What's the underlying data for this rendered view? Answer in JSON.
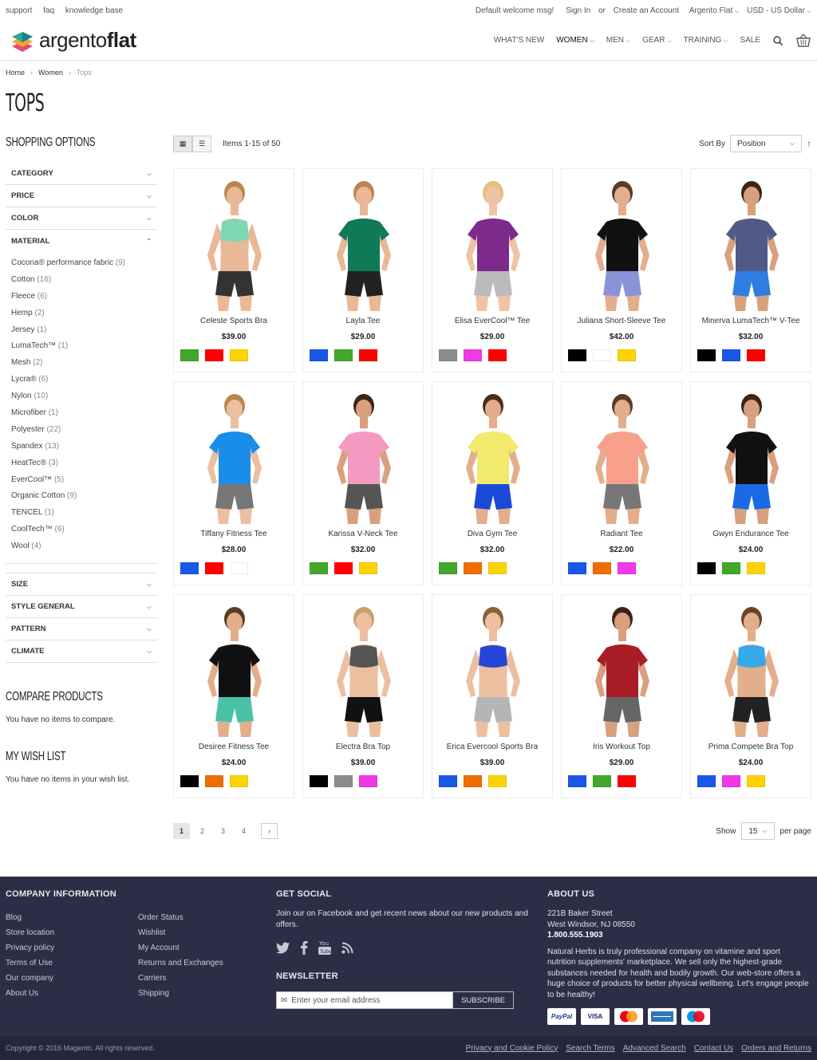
{
  "topbar": {
    "links": [
      "support",
      "faq",
      "knowledge base"
    ],
    "welcome": "Default welcome msg!",
    "sign_in": "Sign In",
    "or": "or",
    "create_account": "Create an Account",
    "store": "Argento Flat",
    "currency": "USD - US Dollar"
  },
  "header": {
    "logo_light": "argento",
    "logo_bold": "flat",
    "nav": [
      "WHAT'S NEW",
      "WOMEN",
      "MEN",
      "GEAR",
      "TRAINING",
      "SALE"
    ]
  },
  "breadcrumbs": [
    "Home",
    "Women",
    "Tops"
  ],
  "page_title": "TOPS",
  "sidebar": {
    "title": "SHOPPING OPTIONS",
    "filters": [
      "CATEGORY",
      "PRICE",
      "COLOR",
      "MATERIAL"
    ],
    "material_options": [
      {
        "label": "Cocona® performance fabric",
        "count": "(9)"
      },
      {
        "label": "Cotton",
        "count": "(16)"
      },
      {
        "label": "Fleece",
        "count": "(6)"
      },
      {
        "label": "Hemp",
        "count": "(2)"
      },
      {
        "label": "Jersey",
        "count": "(1)"
      },
      {
        "label": "LumaTech™",
        "count": "(1)"
      },
      {
        "label": "Mesh",
        "count": "(2)"
      },
      {
        "label": "Lycra®",
        "count": "(6)"
      },
      {
        "label": "Nylon",
        "count": "(10)"
      },
      {
        "label": "Microfiber",
        "count": "(1)"
      },
      {
        "label": "Polyester",
        "count": "(22)"
      },
      {
        "label": "Spandex",
        "count": "(13)"
      },
      {
        "label": "HeatTec®",
        "count": "(3)"
      },
      {
        "label": "EverCool™",
        "count": "(5)"
      },
      {
        "label": "Organic Cotton",
        "count": "(9)"
      },
      {
        "label": "TENCEL",
        "count": "(1)"
      },
      {
        "label": "CoolTech™",
        "count": "(6)"
      },
      {
        "label": "Wool",
        "count": "(4)"
      }
    ],
    "filters_after": [
      "SIZE",
      "STYLE GENERAL",
      "PATTERN",
      "CLIMATE"
    ],
    "compare_title": "COMPARE PRODUCTS",
    "compare_text": "You have no items to compare.",
    "wishlist_title": "MY WISH LIST",
    "wishlist_text": "You have no items in your wish list."
  },
  "toolbar": {
    "amount": "Items 1-15 of 50",
    "sort_label": "Sort By",
    "sort_value": "Position"
  },
  "products": [
    {
      "name": "Celeste Sports Bra",
      "price": "$39.00",
      "swatches": [
        "#43a82a",
        "#ff0000",
        "#ffd300"
      ],
      "top": "#7fd6b5",
      "skin": "#e9b896",
      "hair": "#b9864e",
      "bottom": "#333333",
      "cover": "bra"
    },
    {
      "name": "Layla Tee",
      "price": "$29.00",
      "swatches": [
        "#1a57e8",
        "#43a82a",
        "#ff0000"
      ],
      "top": "#0f7a55",
      "skin": "#e9b896",
      "hair": "#b9864e",
      "bottom": "#222222",
      "cover": "tee"
    },
    {
      "name": "Elisa EverCool™ Tee",
      "price": "$29.00",
      "swatches": [
        "#8c8c8c",
        "#f03ae6",
        "#ff0000"
      ],
      "top": "#7c2a8c",
      "skin": "#efc3a3",
      "hair": "#e3c07a",
      "bottom": "#bbbbbb",
      "cover": "tee"
    },
    {
      "name": "Juliana Short-Sleeve Tee",
      "price": "$42.00",
      "swatches": [
        "#000000",
        "#ffffff",
        "#ffd300"
      ],
      "top": "#111111",
      "skin": "#e3ae8c",
      "hair": "#5a3b24",
      "bottom": "#8a93d8",
      "cover": "tee"
    },
    {
      "name": "Minerva LumaTech™ V-Tee",
      "price": "$32.00",
      "swatches": [
        "#000000",
        "#1a57e8",
        "#ff0000"
      ],
      "top": "#515a86",
      "skin": "#d9a07e",
      "hair": "#3a2616",
      "bottom": "#2f7de0",
      "cover": "tee"
    },
    {
      "name": "Tiffany Fitness Tee",
      "price": "$28.00",
      "swatches": [
        "#1a57e8",
        "#ff0000",
        "#ffffff"
      ],
      "top": "#1a8de8",
      "skin": "#ecbfa0",
      "hair": "#b9864e",
      "bottom": "#777777",
      "cover": "tee"
    },
    {
      "name": "Karissa V-Neck Tee",
      "price": "$32.00",
      "swatches": [
        "#43a82a",
        "#ff0000",
        "#ffd300"
      ],
      "top": "#f49ac0",
      "skin": "#d9a07e",
      "hair": "#3a2616",
      "bottom": "#555555",
      "cover": "tee"
    },
    {
      "name": "Diva Gym Tee",
      "price": "$32.00",
      "swatches": [
        "#43a82a",
        "#f06e00",
        "#ffd300"
      ],
      "top": "#f2ea6c",
      "skin": "#e3ae8c",
      "hair": "#4a2e1c",
      "bottom": "#1a49d8",
      "cover": "tee"
    },
    {
      "name": "Radiant Tee",
      "price": "$22.00",
      "swatches": [
        "#1a57e8",
        "#f06e00",
        "#f03ae6"
      ],
      "top": "#f8a08c",
      "skin": "#e3ae8c",
      "hair": "#5a3b24",
      "bottom": "#777777",
      "cover": "tee"
    },
    {
      "name": "Gwyn Endurance Tee",
      "price": "$24.00",
      "swatches": [
        "#000000",
        "#43a82a",
        "#ffd300"
      ],
      "top": "#111111",
      "skin": "#d9a07e",
      "hair": "#3a2616",
      "bottom": "#1a6ae8",
      "cover": "tee"
    },
    {
      "name": "Desiree Fitness Tee",
      "price": "$24.00",
      "swatches": [
        "#000000",
        "#f06e00",
        "#ffd300"
      ],
      "top": "#111111",
      "skin": "#e3ae8c",
      "hair": "#5a3b24",
      "bottom": "#49c2a8",
      "cover": "tee"
    },
    {
      "name": "Electra Bra Top",
      "price": "$39.00",
      "swatches": [
        "#000000",
        "#8c8c8c",
        "#f03ae6"
      ],
      "top": "#555555",
      "skin": "#ecbfa0",
      "hair": "#c9a06a",
      "bottom": "#111111",
      "cover": "bra"
    },
    {
      "name": "Erica Evercool Sports Bra",
      "price": "$39.00",
      "swatches": [
        "#1a57e8",
        "#f06e00",
        "#ffd300"
      ],
      "top": "#2746d8",
      "skin": "#ecbfa0",
      "hair": "#8a6238",
      "bottom": "#b5b5b5",
      "cover": "bra"
    },
    {
      "name": "Iris Workout Top",
      "price": "$29.00",
      "swatches": [
        "#1a57e8",
        "#43a82a",
        "#ff0000"
      ],
      "top": "#a81c26",
      "skin": "#d9a07e",
      "hair": "#3a2616",
      "bottom": "#666666",
      "cover": "tee"
    },
    {
      "name": "Prima Compete Bra Top",
      "price": "$24.00",
      "swatches": [
        "#1a57e8",
        "#f03ae6",
        "#ffd300"
      ],
      "top": "#35a9ea",
      "skin": "#e3ae8c",
      "hair": "#6a4428",
      "bottom": "#222222",
      "cover": "bra"
    }
  ],
  "pager": {
    "pages": [
      "1",
      "2",
      "3",
      "4"
    ],
    "show_label": "Show",
    "limit": "15",
    "per_page": "per page"
  },
  "footer": {
    "company_title": "COMPANY INFORMATION",
    "company_links_1": [
      "Blog",
      "Store location",
      "Privacy policy",
      "Terms of Use",
      "Our company",
      "About Us"
    ],
    "company_links_2": [
      "Order Status",
      "Wishlist",
      "My Account",
      "Returns and Exchanges",
      "Carriers",
      "Shipping"
    ],
    "social_title": "GET SOCIAL",
    "social_text": "Join our on Facebook and get recent news about our new products and offers.",
    "newsletter_title": "NEWSLETTER",
    "newsletter_placeholder": "Enter your email address",
    "subscribe": "SUBSCRIBE",
    "about_title": "ABOUT US",
    "address_1": "221B Baker Street",
    "address_2": "West Windsor, NJ 08550",
    "phone": "1.800.555.1903",
    "about_text": "Natural Herbs is truly professional company on vitamine and sport nutrition supplements' marketplace. We sell only the highest-grade substances needed for health and bodily growth. Our web-store offers a huge choice of products for better physical wellbeing. Let's engage people to be healthy!",
    "payments": [
      "PayPal",
      "VISA",
      "MasterCard",
      "American Express",
      "Maestro"
    ]
  },
  "bottom": {
    "copyright": "Copyright © 2016 Magento. All rights reserved.",
    "links": [
      "Privacy and Cookie Policy",
      "Search Terms",
      "Advanced Search",
      "Contact Us",
      "Orders and Returns"
    ]
  },
  "colors": {
    "footer_bg": "#2d2e46",
    "link_blue": "#1979c3"
  }
}
